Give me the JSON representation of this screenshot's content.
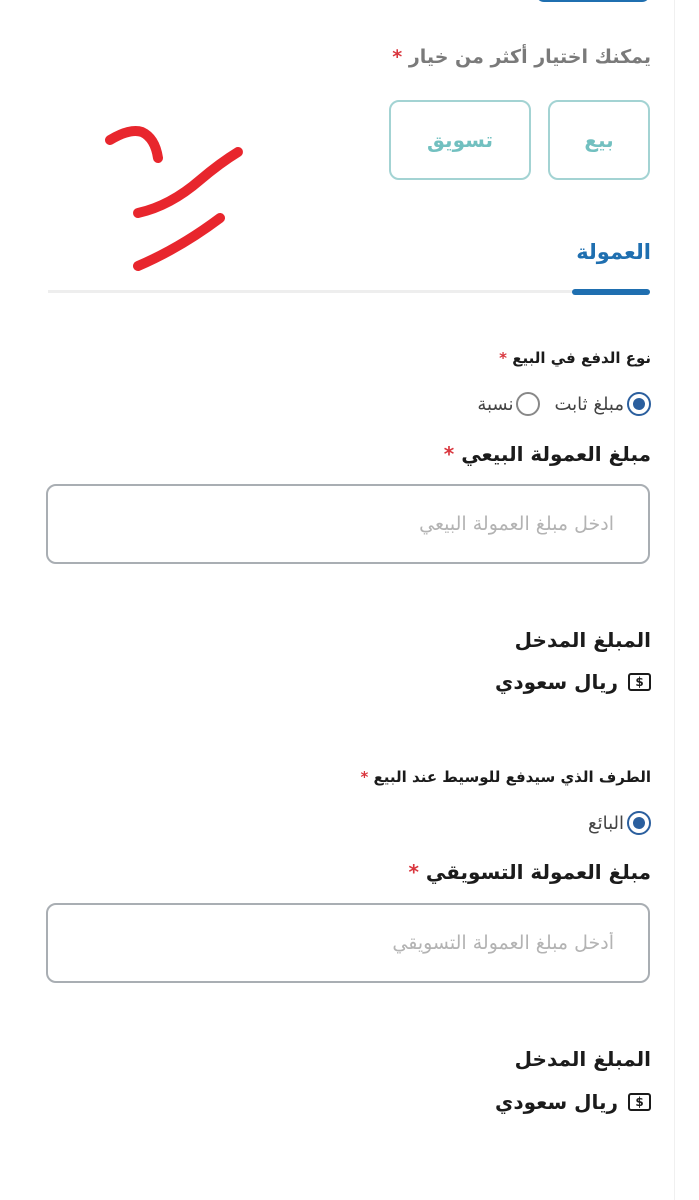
{
  "deal_type": {
    "hint": "يمكنك اختيار أكثر من خيار",
    "required_mark": "*",
    "options": [
      {
        "label": "بيع"
      },
      {
        "label": "تسويق"
      }
    ]
  },
  "tabs": {
    "active_label": "العمولة"
  },
  "commission": {
    "payment_type_label": "نوع الدفع في البيع",
    "required_mark": "*",
    "payment_options": [
      {
        "label": "مبلغ ثابت",
        "selected": true
      },
      {
        "label": "نسبة",
        "selected": false
      }
    ],
    "sale_amount_label": "مبلغ العمولة البيعي",
    "sale_amount_placeholder": "ادخل مبلغ العمولة البيعي",
    "sale_entered_title": "المبلغ المدخل",
    "sale_entered_currency": "ريال سعودي",
    "payer_label": "الطرف الذي سيدفع للوسيط عند البيع",
    "payer_options": [
      {
        "label": "البائع",
        "selected": true
      }
    ],
    "marketing_amount_label": "مبلغ العمولة التسويقي",
    "marketing_amount_placeholder": "أدخل مبلغ العمولة التسويقي",
    "marketing_entered_title": "المبلغ المدخل",
    "marketing_entered_currency": "ريال سعودي",
    "currency_icon_glyph": "$"
  },
  "colors": {
    "primary": "#1f6fb0",
    "option_border": "#a3d3d3",
    "option_text": "#72c0c0",
    "required": "#d9363e",
    "annotation": "#e8262d"
  }
}
